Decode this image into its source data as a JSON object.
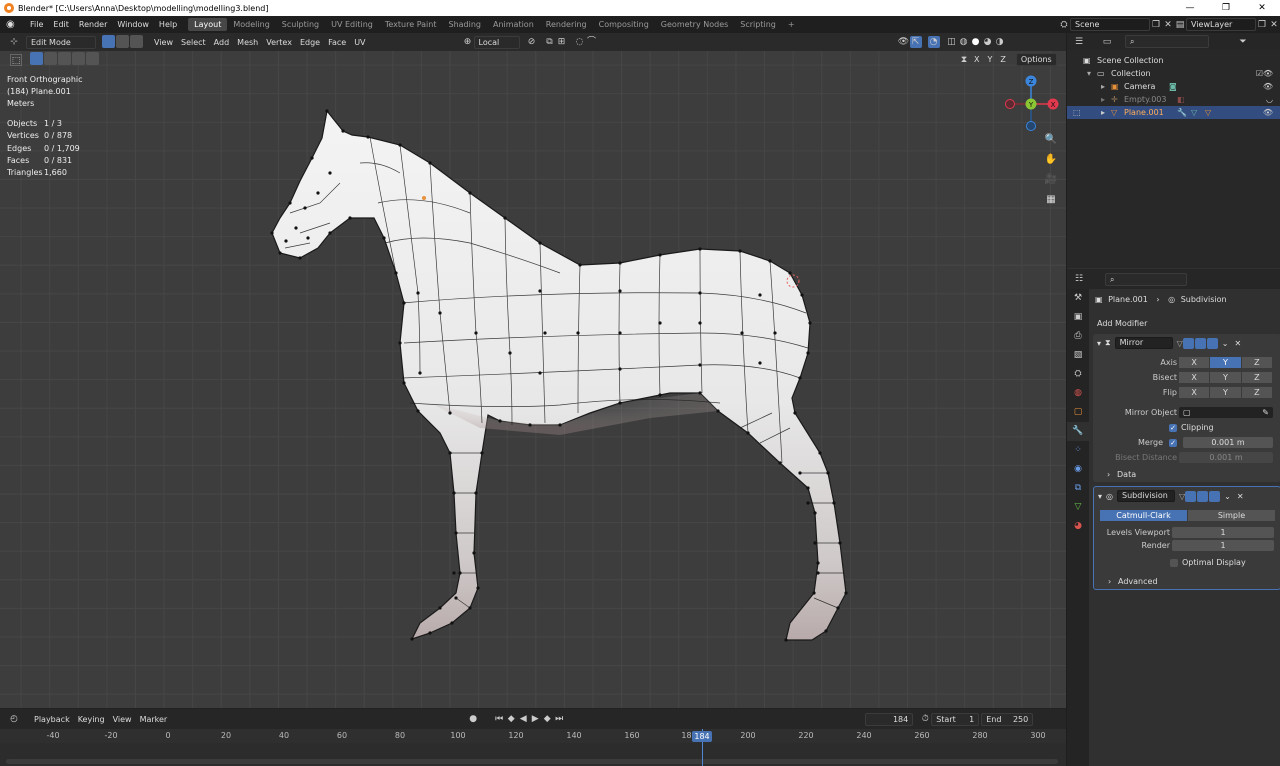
{
  "window": {
    "title": "Blender* [C:\\Users\\Anna\\Desktop\\modelling\\modelling3.blend]",
    "controls": [
      "—",
      "❐",
      "✕"
    ]
  },
  "menu": [
    "File",
    "Edit",
    "Render",
    "Window",
    "Help"
  ],
  "workspaces": [
    "Layout",
    "Modeling",
    "Sculpting",
    "UV Editing",
    "Texture Paint",
    "Shading",
    "Animation",
    "Rendering",
    "Compositing",
    "Geometry Nodes",
    "Scripting"
  ],
  "active_workspace": "Layout",
  "scene": {
    "name": "Scene",
    "view_layer": "ViewLayer"
  },
  "viewport_header": {
    "mode": "Edit Mode",
    "menus": [
      "View",
      "Select",
      "Add",
      "Mesh",
      "Vertex",
      "Edge",
      "Face",
      "UV"
    ],
    "transform_orientation": "Local",
    "options_label": "Options",
    "axis_buttons": [
      "X",
      "Y",
      "Z"
    ]
  },
  "overlay_info": {
    "view_name": "Front Orthographic",
    "object_line": "(184) Plane.001",
    "units": "Meters",
    "stats": [
      {
        "label": "Objects",
        "value": "1 / 3"
      },
      {
        "label": "Vertices",
        "value": "0 / 878"
      },
      {
        "label": "Edges",
        "value": "0 / 1,709"
      },
      {
        "label": "Faces",
        "value": "0 / 831"
      },
      {
        "label": "Triangles",
        "value": "1,660"
      }
    ]
  },
  "gizmo": {
    "x": "X",
    "y": "Y",
    "z": "Z",
    "x_color": "#e2394f",
    "y_color": "#8bc534",
    "z_color": "#3b86dd"
  },
  "timeline": {
    "menus": [
      "Playback",
      "Keying",
      "View",
      "Marker"
    ],
    "current_frame": "184",
    "start_label": "Start",
    "start": "1",
    "end_label": "End",
    "end": "250",
    "ticks": [
      "-40",
      "-20",
      "0",
      "20",
      "40",
      "60",
      "80",
      "100",
      "120",
      "140",
      "160",
      "180",
      "200",
      "220",
      "240",
      "260",
      "280",
      "300"
    ]
  },
  "outliner": {
    "root": "Scene Collection",
    "items": [
      {
        "name": "Collection",
        "indent": 1
      },
      {
        "name": "Camera",
        "indent": 2
      },
      {
        "name": "Empty.003",
        "indent": 2
      },
      {
        "name": "Plane.001",
        "indent": 2,
        "selected": true
      }
    ]
  },
  "properties": {
    "breadcrumb_object": "Plane.001",
    "breadcrumb_modifier": "Subdivision",
    "add_modifier": "Add Modifier",
    "mirror": {
      "name": "Mirror",
      "axis_label": "Axis",
      "bisect_label": "Bisect",
      "flip_label": "Flip",
      "axes": [
        "X",
        "Y",
        "Z"
      ],
      "mirror_object_label": "Mirror Object",
      "clipping_label": "Clipping",
      "merge_label": "Merge",
      "merge_value": "0.001 m",
      "bisect_distance_label": "Bisect Distance",
      "bisect_distance_value": "0.001 m",
      "data_label": "Data"
    },
    "subdivision": {
      "name": "Subdivision",
      "mode_a": "Catmull-Clark",
      "mode_b": "Simple",
      "levels_viewport_label": "Levels Viewport",
      "levels_viewport": "1",
      "render_label": "Render",
      "render": "1",
      "optimal_display_label": "Optimal Display",
      "advanced_label": "Advanced"
    }
  },
  "colors": {
    "accent": "#4772b3",
    "selected_row": "#334d80",
    "viewport_bg": "#3d3d3d"
  }
}
